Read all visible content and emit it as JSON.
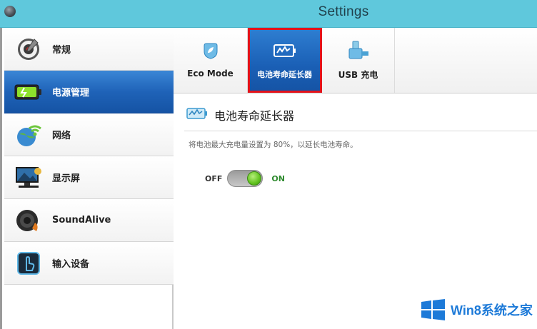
{
  "window": {
    "title": "Settings"
  },
  "sidebar": {
    "items": [
      {
        "label": "常规",
        "icon": "gear-icon"
      },
      {
        "label": "电源管理",
        "icon": "battery-icon",
        "active": true
      },
      {
        "label": "网络",
        "icon": "wifi-globe-icon"
      },
      {
        "label": "显示屏",
        "icon": "display-icon"
      },
      {
        "label": "SoundAlive",
        "icon": "speaker-icon"
      },
      {
        "label": "输入设备",
        "icon": "touch-hand-icon"
      }
    ]
  },
  "tabs": [
    {
      "label": "Eco Mode",
      "icon": "eco-leaf-icon"
    },
    {
      "label": "电池寿命延长器",
      "icon": "battery-extender-icon",
      "active": true
    },
    {
      "label": "USB 充电",
      "icon": "usb-charge-icon"
    }
  ],
  "section": {
    "title": "电池寿命延长器",
    "description": "将电池最大充电量设置为 80%，以延长电池寿命。",
    "toggle": {
      "off_label": "OFF",
      "on_label": "ON",
      "state": "on"
    }
  },
  "watermark": {
    "text": "Win8系统之家"
  },
  "colors": {
    "titlebar": "#5fc8dc",
    "selected_blue": "#1f63b8",
    "highlight_red": "#e3131b",
    "toggle_green": "#61c21e"
  }
}
